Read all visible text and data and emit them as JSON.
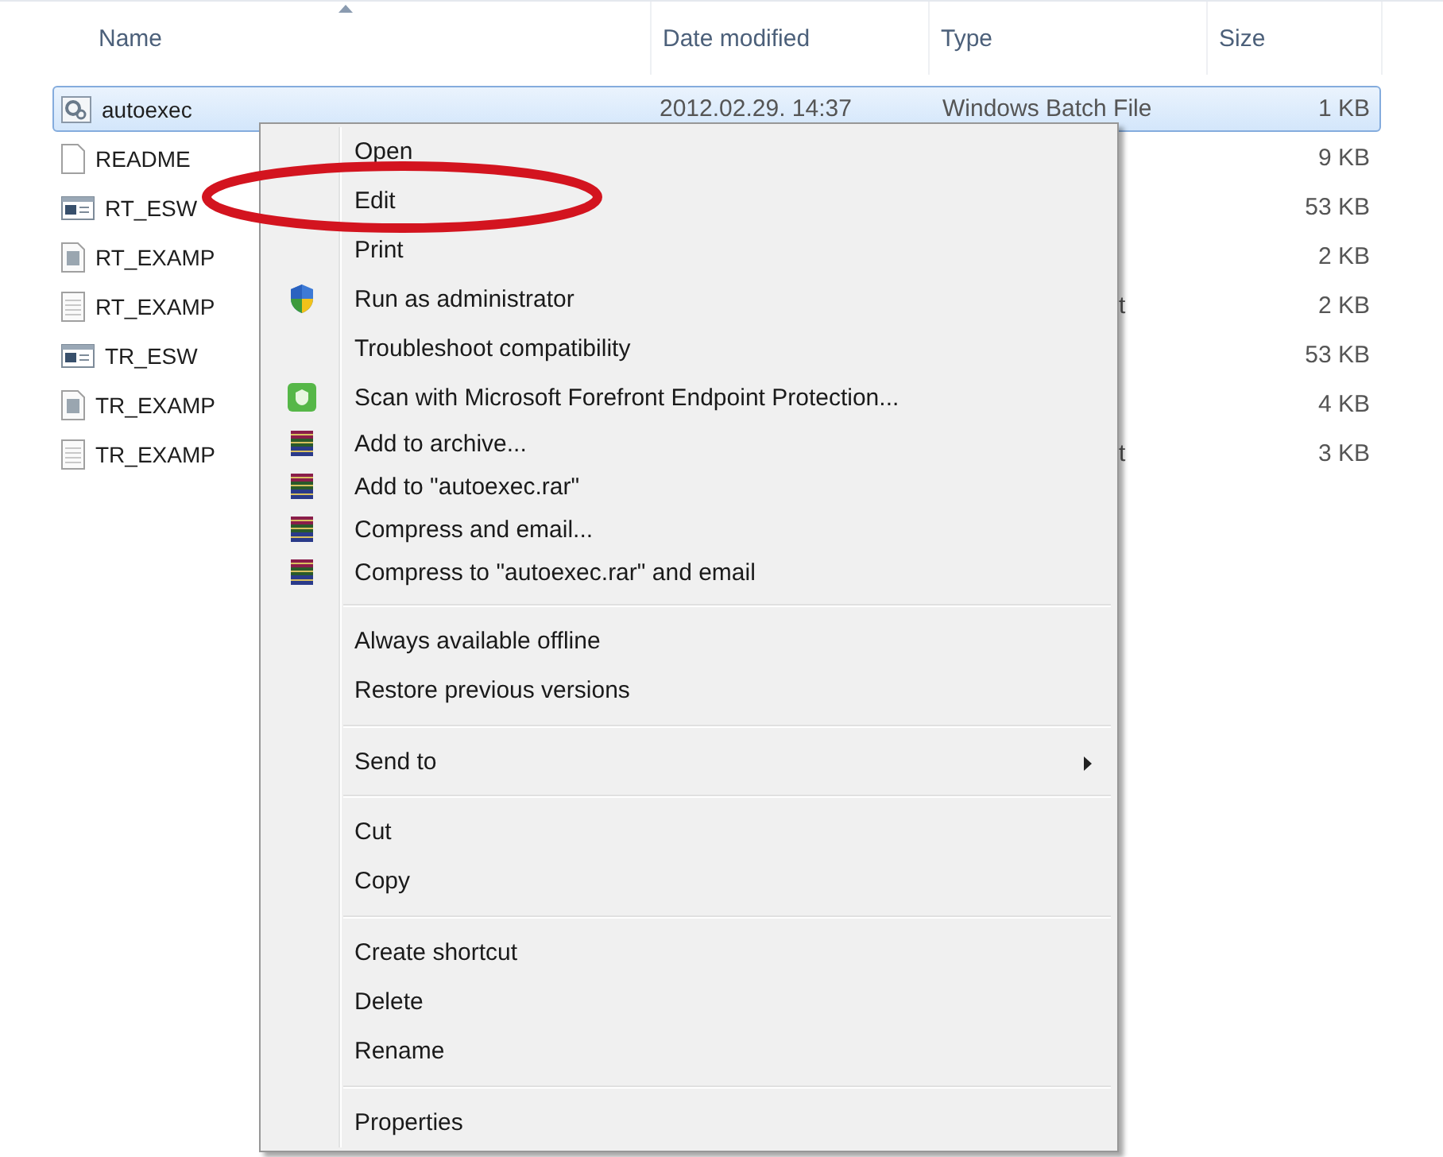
{
  "columns": [
    {
      "label": "Name",
      "sorted": true
    },
    {
      "label": "Date modified",
      "sorted": false
    },
    {
      "label": "Type",
      "sorted": false
    },
    {
      "label": "Size",
      "sorted": false
    }
  ],
  "files": [
    {
      "name": "autoexec",
      "kind": "batch",
      "date": "2012.02.29. 14:37",
      "type": "Windows Batch File",
      "size": "1 KB",
      "selected": true
    },
    {
      "name": "README",
      "kind": "blank",
      "size": "9 KB",
      "selected": false
    },
    {
      "name": "RT_ESW",
      "kind": "app",
      "size": "53 KB",
      "selected": false
    },
    {
      "name": "RT_EXAMP",
      "kind": "image",
      "size": "2 KB",
      "selected": false
    },
    {
      "name": "RT_EXAMP",
      "kind": "notepad",
      "type": "t",
      "type_cut": true,
      "size": "2 KB",
      "selected": false
    },
    {
      "name": "TR_ESW",
      "kind": "app",
      "size": "53 KB",
      "selected": false
    },
    {
      "name": "TR_EXAMP",
      "kind": "image",
      "size": "4 KB",
      "selected": false
    },
    {
      "name": "TR_EXAMP",
      "kind": "notepad",
      "type": "t",
      "type_cut": true,
      "size": "3 KB",
      "selected": false
    }
  ],
  "context_menu": [
    {
      "kind": "item",
      "label": "Open"
    },
    {
      "kind": "item",
      "label": "Edit"
    },
    {
      "kind": "item",
      "label": "Print"
    },
    {
      "kind": "shield",
      "label": "Run as administrator"
    },
    {
      "kind": "item",
      "label": "Troubleshoot compatibility"
    },
    {
      "kind": "antivirus",
      "label": "Scan with Microsoft Forefront Endpoint Protection..."
    },
    {
      "kind": "archive",
      "label": "Add to archive..."
    },
    {
      "kind": "archive",
      "label": "Add to \"autoexec.rar\""
    },
    {
      "kind": "archive",
      "label": "Compress and email..."
    },
    {
      "kind": "archive",
      "label": "Compress to \"autoexec.rar\" and email"
    },
    {
      "kind": "separator"
    },
    {
      "kind": "item",
      "label": "Always available offline"
    },
    {
      "kind": "item",
      "label": "Restore previous versions"
    },
    {
      "kind": "separator"
    },
    {
      "kind": "item",
      "label": "Send to",
      "submenu": true
    },
    {
      "kind": "separator"
    },
    {
      "kind": "item",
      "label": "Cut"
    },
    {
      "kind": "item",
      "label": "Copy"
    },
    {
      "kind": "separator"
    },
    {
      "kind": "item",
      "label": "Create shortcut"
    },
    {
      "kind": "item",
      "label": "Delete"
    },
    {
      "kind": "item",
      "label": "Rename"
    },
    {
      "kind": "separator"
    },
    {
      "kind": "item",
      "label": "Properties"
    }
  ],
  "annotation": {
    "kind": "ellipse"
  }
}
